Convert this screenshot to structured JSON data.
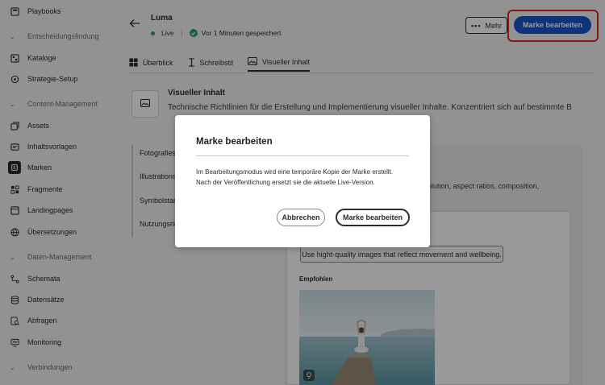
{
  "sidebar": {
    "items": [
      {
        "label": "Playbooks",
        "icon": "playbooks-icon"
      },
      {
        "label": "Kataloge",
        "icon": "catalog-icon"
      },
      {
        "label": "Strategie-Setup",
        "icon": "strategy-icon"
      },
      {
        "label": "Assets",
        "icon": "assets-icon"
      },
      {
        "label": "Inhaltsvorlagen",
        "icon": "templates-icon"
      },
      {
        "label": "Marken",
        "icon": "brands-icon",
        "active": true
      },
      {
        "label": "Fragmente",
        "icon": "fragments-icon"
      },
      {
        "label": "Landingpages",
        "icon": "landingpages-icon"
      },
      {
        "label": "Übersetzungen",
        "icon": "globe-icon"
      },
      {
        "label": "Schemata",
        "icon": "schema-icon"
      },
      {
        "label": "Datensätze",
        "icon": "database-icon"
      },
      {
        "label": "Abfragen",
        "icon": "query-icon"
      },
      {
        "label": "Monitoring",
        "icon": "monitoring-icon"
      }
    ],
    "sections": [
      {
        "label": "Entscheidungsfindung"
      },
      {
        "label": "Content-Management"
      },
      {
        "label": "Daten-Management"
      },
      {
        "label": "Verbindungen"
      }
    ]
  },
  "header": {
    "title": "Luma",
    "status_live": "Live",
    "saved_text": "Vor 1 Minuten gespeichert",
    "more_label": "Mehr",
    "edit_brand_label": "Marke bearbeiten"
  },
  "tabs": [
    {
      "label": "Überblick"
    },
    {
      "label": "Schreibstil"
    },
    {
      "label": "Visueller Inhalt"
    }
  ],
  "content": {
    "section_title": "Visueller Inhalt",
    "section_desc": "Technische Richtlinien für die Erstellung und Implementierung visueller Inhalte. Konzentriert sich auf bestimmte B",
    "left_items": [
      "Fotografiest",
      "Illustrations",
      "Symbolstan",
      "Nutzungsric"
    ],
    "right_text": "g resolution, aspect ratios, composition,",
    "chip_text": "Use hight-quality images that reflect movement and wellbeing.",
    "recommended_label": "Empfohlen"
  },
  "modal": {
    "title": "Marke bearbeiten",
    "body_line1": "Im Bearbeitungsmodus wird eine temporäre Kopie der Marke erstellt.",
    "body_line2": "Nach der Veröffentlichung ersetzt sie die aktuelle Live-Version.",
    "cancel_label": "Abbrechen",
    "confirm_label": "Marke bearbeiten"
  },
  "colors": {
    "primary": "#1856c7",
    "live": "#2d9d78",
    "highlight": "#e0261b"
  }
}
